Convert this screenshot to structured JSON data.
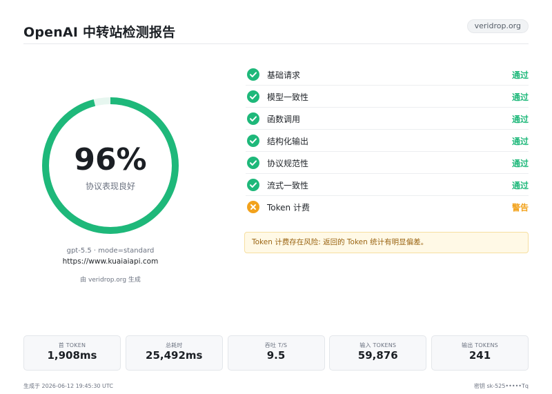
{
  "header": {
    "title": "OpenAI 中转站检测报告",
    "badge": "veridrop.org"
  },
  "score": {
    "value": "96%",
    "fraction": 0.96,
    "label": "协议表现良好",
    "ring_color": "#1eb87a"
  },
  "meta": {
    "model_line": "gpt-5.5 · mode=standard",
    "url": "https://www.kuaiaiapi.com",
    "generated_by": "由 veridrop.org 生成"
  },
  "checks": [
    {
      "label": "基础请求",
      "status": "通过",
      "state": "pass",
      "icon": "check-icon"
    },
    {
      "label": "模型一致性",
      "status": "通过",
      "state": "pass",
      "icon": "check-icon"
    },
    {
      "label": "函数调用",
      "status": "通过",
      "state": "pass",
      "icon": "check-icon"
    },
    {
      "label": "结构化输出",
      "status": "通过",
      "state": "pass",
      "icon": "check-icon"
    },
    {
      "label": "协议规范性",
      "status": "通过",
      "state": "pass",
      "icon": "check-icon"
    },
    {
      "label": "流式一致性",
      "status": "通过",
      "state": "pass",
      "icon": "check-icon"
    },
    {
      "label": "Token 计费",
      "status": "警告",
      "state": "warn",
      "icon": "cross-icon"
    }
  ],
  "warning": "Token 计费存在风险: 返回的 Token 统计有明显偏差。",
  "stats": [
    {
      "label": "首 TOKEN",
      "value": "1,908ms"
    },
    {
      "label": "总耗时",
      "value": "25,492ms"
    },
    {
      "label": "吞吐 T/S",
      "value": "9.5"
    },
    {
      "label": "输入 TOKENS",
      "value": "59,876"
    },
    {
      "label": "输出 TOKENS",
      "value": "241"
    }
  ],
  "footer": {
    "generated_at": "生成于 2026-06-12 19:45:30 UTC",
    "key": "密钥 sk-525•••••Tq"
  },
  "colors": {
    "pass": "#1eb87a",
    "warn": "#f2a21c"
  }
}
